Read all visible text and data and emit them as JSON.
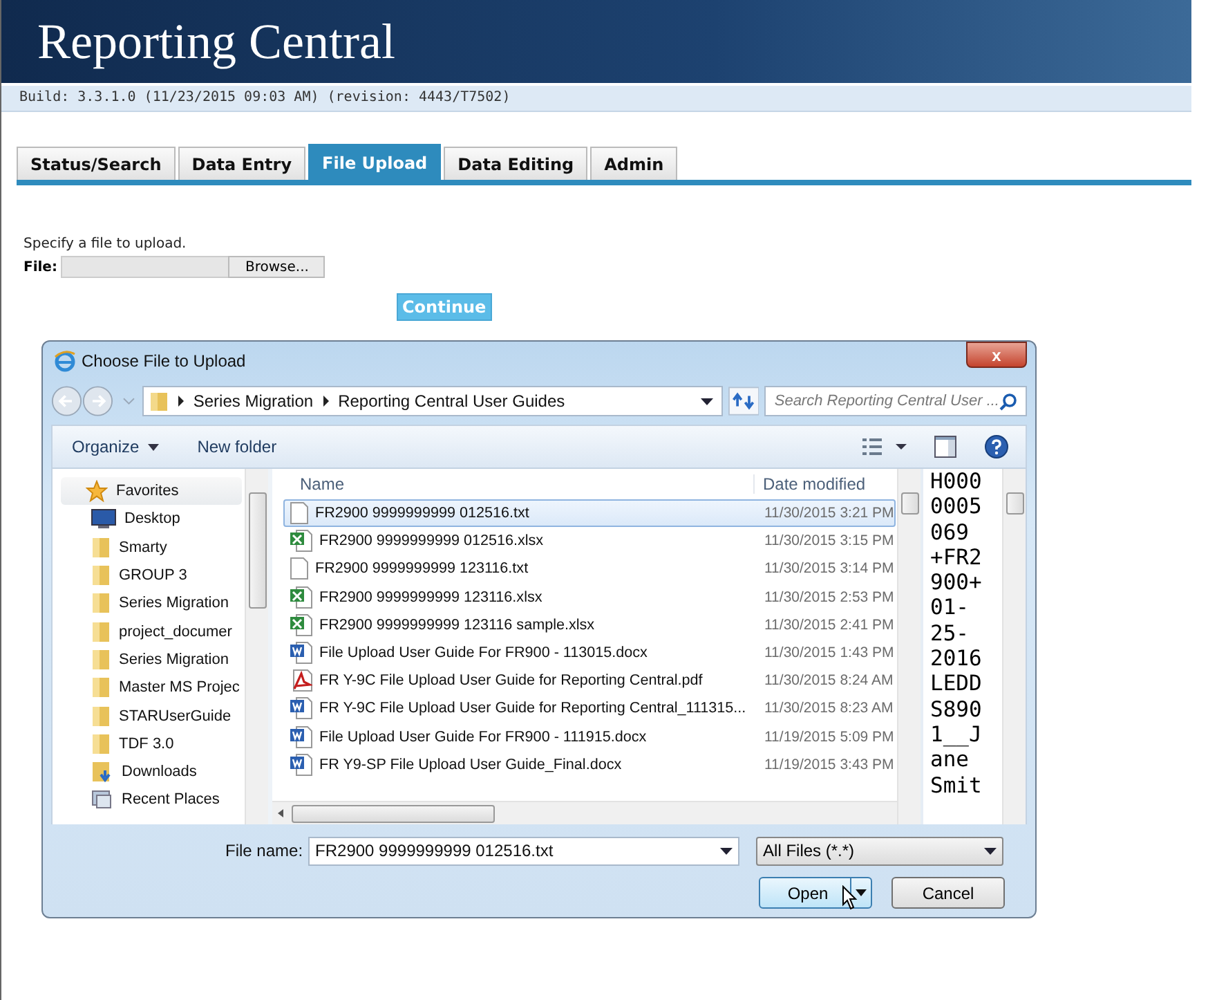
{
  "header": {
    "title": "Reporting Central",
    "build": "Build: 3.3.1.0 (11/23/2015 09:03 AM) (revision: 4443/T7502)"
  },
  "tabs": [
    {
      "label": "Status/Search",
      "selected": false
    },
    {
      "label": "Data Entry",
      "selected": false
    },
    {
      "label": "File Upload",
      "selected": true
    },
    {
      "label": "Data Editing",
      "selected": false
    },
    {
      "label": "Admin",
      "selected": false
    }
  ],
  "upload": {
    "instruction": "Specify a file to upload.",
    "file_label": "File:",
    "browse": "Browse...",
    "continue": "Continue"
  },
  "dialog": {
    "title": "Choose File to Upload",
    "close": "x",
    "breadcrumb": [
      "Series Migration",
      "Reporting Central User Guides"
    ],
    "search": {
      "placeholder": "Search Reporting Central User ..."
    },
    "toolbar": [
      "Organize",
      "New folder"
    ],
    "sidebar": [
      {
        "label": "Favorites",
        "kind": "star"
      },
      {
        "label": "Desktop",
        "kind": "desktop"
      },
      {
        "label": "Smarty",
        "kind": "folder"
      },
      {
        "label": "GROUP 3",
        "kind": "folder"
      },
      {
        "label": "Series Migration",
        "kind": "folder"
      },
      {
        "label": "project_documer",
        "kind": "folder"
      },
      {
        "label": "Series Migration",
        "kind": "folder"
      },
      {
        "label": "Master MS Projec",
        "kind": "folder"
      },
      {
        "label": "STARUserGuide",
        "kind": "folder"
      },
      {
        "label": "TDF 3.0",
        "kind": "folder"
      },
      {
        "label": "Downloads",
        "kind": "downloads"
      },
      {
        "label": "Recent Places",
        "kind": "recent"
      }
    ],
    "columns": [
      "Name",
      "Date modified"
    ],
    "files": [
      {
        "name": "FR2900 9999999999 012516.txt",
        "date": "11/30/2015 3:21 PM",
        "kind": "txt",
        "selected": true
      },
      {
        "name": "FR2900 9999999999 012516.xlsx",
        "date": "11/30/2015 3:15 PM",
        "kind": "xlsx",
        "selected": false
      },
      {
        "name": "FR2900 9999999999 123116.txt",
        "date": "11/30/2015 3:14 PM",
        "kind": "txt",
        "selected": false
      },
      {
        "name": "FR2900 9999999999 123116.xlsx",
        "date": "11/30/2015 2:53 PM",
        "kind": "xlsx",
        "selected": false
      },
      {
        "name": "FR2900 9999999999 123116 sample.xlsx",
        "date": "11/30/2015 2:41 PM",
        "kind": "xlsx",
        "selected": false
      },
      {
        "name": "File Upload User Guide For FR900 - 113015.docx",
        "date": "11/30/2015 1:43 PM",
        "kind": "docx",
        "selected": false
      },
      {
        "name": "FR Y-9C File Upload User Guide for Reporting Central.pdf",
        "date": "11/30/2015 8:24 AM",
        "kind": "pdf",
        "selected": false
      },
      {
        "name": "FR Y-9C File Upload User Guide for Reporting Central_111315...",
        "date": "11/30/2015 8:23 AM",
        "kind": "docx",
        "selected": false
      },
      {
        "name": "File Upload User Guide For FR900 - 111915.docx",
        "date": "11/19/2015 5:09 PM",
        "kind": "docx",
        "selected": false
      },
      {
        "name": "FR Y9-SP File Upload User Guide_Final.docx",
        "date": "11/19/2015 3:43 PM",
        "kind": "docx",
        "selected": false
      }
    ],
    "preview": [
      "H000",
      "0005",
      "069",
      "+FR2",
      "900+",
      "01-",
      "25-",
      "2016",
      "LEDD",
      "S890",
      "1__J",
      "ane",
      "Smit"
    ],
    "filename_label": "File name:",
    "filename": "FR2900 9999999999 012516.txt",
    "filter": "All Files (*.*)",
    "buttons": [
      "Open",
      "Cancel"
    ]
  }
}
